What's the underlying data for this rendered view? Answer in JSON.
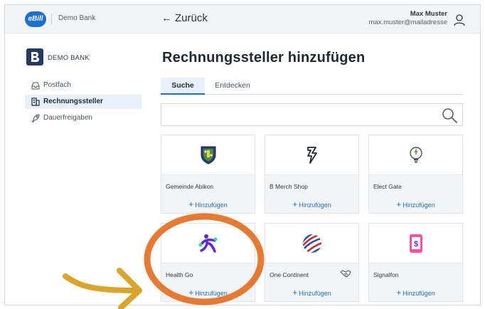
{
  "header": {
    "logo_text": "eBill",
    "bank_name": "Demo Bank",
    "back_label": "Zurück",
    "user_name": "Max Muster",
    "user_email": "max.muster@mailadresse"
  },
  "sidebar": {
    "bank_label": "DEMO BANK",
    "items": [
      {
        "label": "Postfach",
        "icon": "inbox-icon"
      },
      {
        "label": "Rechnungssteller",
        "icon": "building-icon",
        "active": true
      },
      {
        "label": "Dauerfreigaben",
        "icon": "rocket-icon"
      }
    ]
  },
  "main": {
    "title": "Rechnungssteller hinzufügen",
    "tabs": [
      {
        "label": "Suche",
        "active": true
      },
      {
        "label": "Entdecken"
      }
    ],
    "search": {
      "value": "",
      "placeholder": ""
    },
    "add_label": "Hinzufügen",
    "billers": [
      {
        "name": "Gemeinde Abikon",
        "icon": "coat-of-arms-icon"
      },
      {
        "name": "B Merch Shop",
        "icon": "b-merch-logo-icon"
      },
      {
        "name": "Elect Gate",
        "icon": "lightbulb-icon"
      },
      {
        "name": "Health Go",
        "icon": "health-go-logo-icon"
      },
      {
        "name": "One Continent",
        "icon": "globe-stripes-icon",
        "badge": "handshake-icon"
      },
      {
        "name": "Signalfon",
        "icon": "phone-dollar-icon"
      }
    ]
  },
  "colors": {
    "accent": "#1c6fd1",
    "annotation_circle": "#e67a33",
    "annotation_arrow": "#d9a52a"
  }
}
